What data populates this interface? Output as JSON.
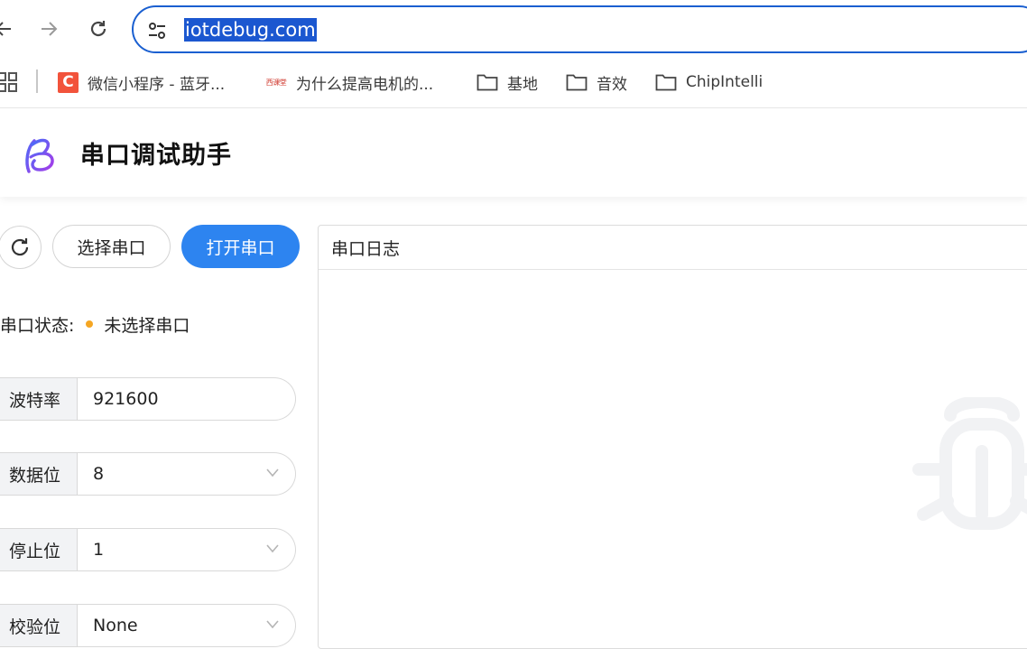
{
  "browser": {
    "url": "iotdebug.com",
    "bookmarks": [
      {
        "label": "微信小程序 - 蓝牙...",
        "icon": "c-logo-favicon"
      },
      {
        "label": "为什么提高电机的...",
        "icon": "red-site-favicon",
        "favicon_text": "西课堂"
      },
      {
        "label": "基地",
        "icon": "folder-icon"
      },
      {
        "label": "音效",
        "icon": "folder-icon"
      },
      {
        "label": "ChipIntelli",
        "icon": "folder-icon"
      }
    ]
  },
  "app": {
    "title": "串口调试助手",
    "logo": "b-letter-logo"
  },
  "controls": {
    "select_port_label": "选择串口",
    "open_port_label": "打开串口",
    "status_label": "串口状态:",
    "status_value": "未选择串口",
    "status_color": "#f5a623",
    "accent_color": "#2d84f0"
  },
  "fields": [
    {
      "label": "波特率",
      "value": "921600",
      "dropdown": false
    },
    {
      "label": "数据位",
      "value": "8",
      "dropdown": true
    },
    {
      "label": "停止位",
      "value": "1",
      "dropdown": true
    },
    {
      "label": "校验位",
      "value": "None",
      "dropdown": true
    }
  ],
  "log": {
    "title": "串口日志",
    "watermark": "bug-icon"
  }
}
